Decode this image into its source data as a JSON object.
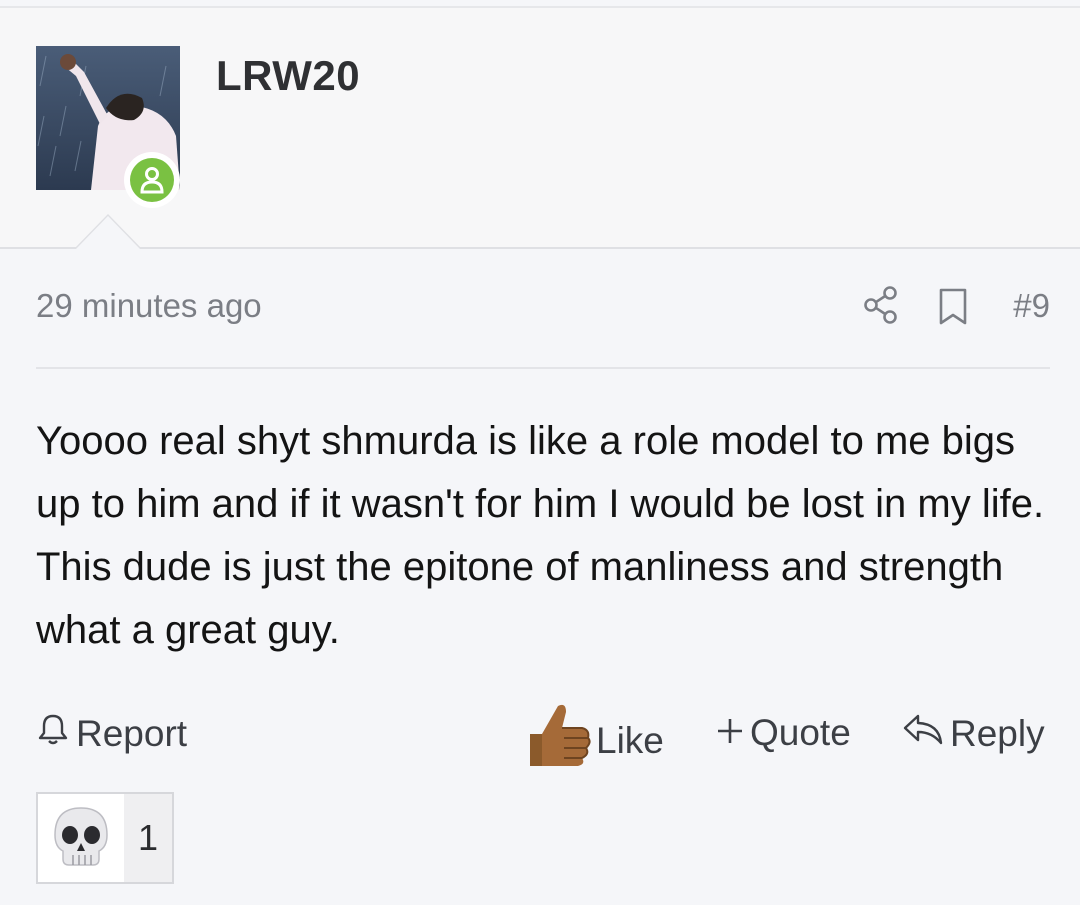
{
  "post": {
    "author": "LRW20",
    "timestamp": "29 minutes ago",
    "post_number": "#9",
    "body": "Yoooo real shyt shmurda is like a role model to me bigs up to him and if it wasn't for him I would be lost in my life. This dude is just the epitone of manliness and strength what a great guy."
  },
  "actions": {
    "report_label": "Report",
    "like_label": "Like",
    "quote_label": "Quote",
    "reply_label": "Reply"
  },
  "reactions": {
    "count": "1",
    "emoji_icon": "skull-emoji"
  },
  "icons": {
    "share": "share-icon",
    "bookmark": "bookmark-icon",
    "report": "bell-icon",
    "like": "thumbs-up-icon",
    "quote": "plus-icon",
    "reply": "reply-arrow-icon",
    "online": "user-online-icon"
  },
  "colors": {
    "online_badge": "#7ac142",
    "background": "#f5f6f9",
    "text_muted": "#7b7e85"
  }
}
